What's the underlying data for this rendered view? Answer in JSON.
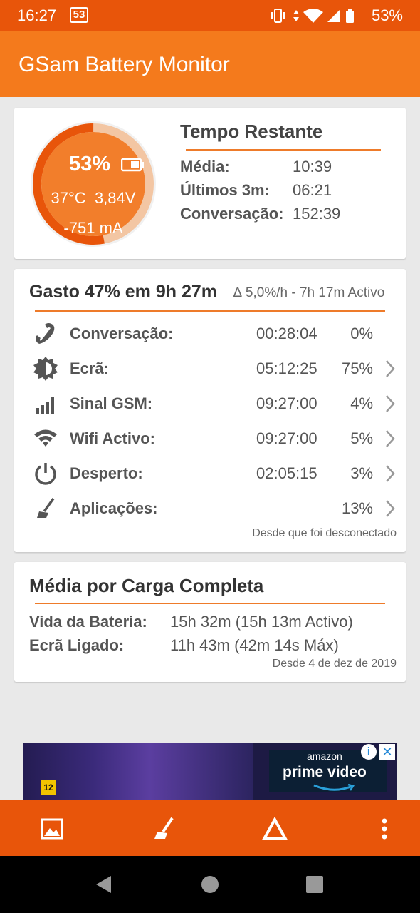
{
  "status_bar": {
    "time": "16:27",
    "notification": "53",
    "battery_percent": "53%"
  },
  "app_bar": {
    "title": "GSam Battery Monitor"
  },
  "battery_summary": {
    "percent": "53%",
    "temperature": "37°C",
    "voltage": "3,84V",
    "current": "-751 mA",
    "level_fraction": 0.53
  },
  "time_remaining": {
    "title": "Tempo Restante",
    "rows": [
      {
        "label": "Média:",
        "value": "10:39"
      },
      {
        "label": "Últimos 3m:",
        "value": "06:21"
      },
      {
        "label": "Conversação:",
        "value": "152:39"
      }
    ]
  },
  "usage": {
    "title": "Gasto 47% em 9h 27m",
    "subtitle": "∆ 5,0%/h - 7h 17m Activo",
    "rows": [
      {
        "icon": "phone-icon",
        "label": "Conversação:",
        "time": "00:28:04",
        "percent": "0%",
        "chevron": false
      },
      {
        "icon": "brightness-icon",
        "label": "Ecrã:",
        "time": "05:12:25",
        "percent": "75%",
        "chevron": true
      },
      {
        "icon": "signal-icon",
        "label": "Sinal GSM:",
        "time": "09:27:00",
        "percent": "4%",
        "chevron": true
      },
      {
        "icon": "wifi-icon",
        "label": "Wifi Activo:",
        "time": "09:27:00",
        "percent": "5%",
        "chevron": true
      },
      {
        "icon": "power-icon",
        "label": "Desperto:",
        "time": "02:05:15",
        "percent": "3%",
        "chevron": true
      },
      {
        "icon": "broom-icon",
        "label": "Aplicações:",
        "time": "",
        "percent": "13%",
        "chevron": true
      }
    ],
    "since": "Desde que foi desconectado"
  },
  "full_charge": {
    "title": "Média por Carga Completa",
    "rows": [
      {
        "label": "Vida da Bateria:",
        "value": "15h 32m (15h 13m Activo)"
      },
      {
        "label": "Ecrã Ligado:",
        "value": "11h 43m (42m 14s Máx)"
      }
    ],
    "since": "Desde 4 de dez de 2019"
  },
  "ad": {
    "rating": "12",
    "brand_top": "amazon",
    "brand_main": "prime video",
    "info": "i",
    "close": "✕"
  },
  "colors": {
    "status_bar": "#e8550a",
    "app_bar": "#f47a1c",
    "accent": "#ee7b2a"
  }
}
